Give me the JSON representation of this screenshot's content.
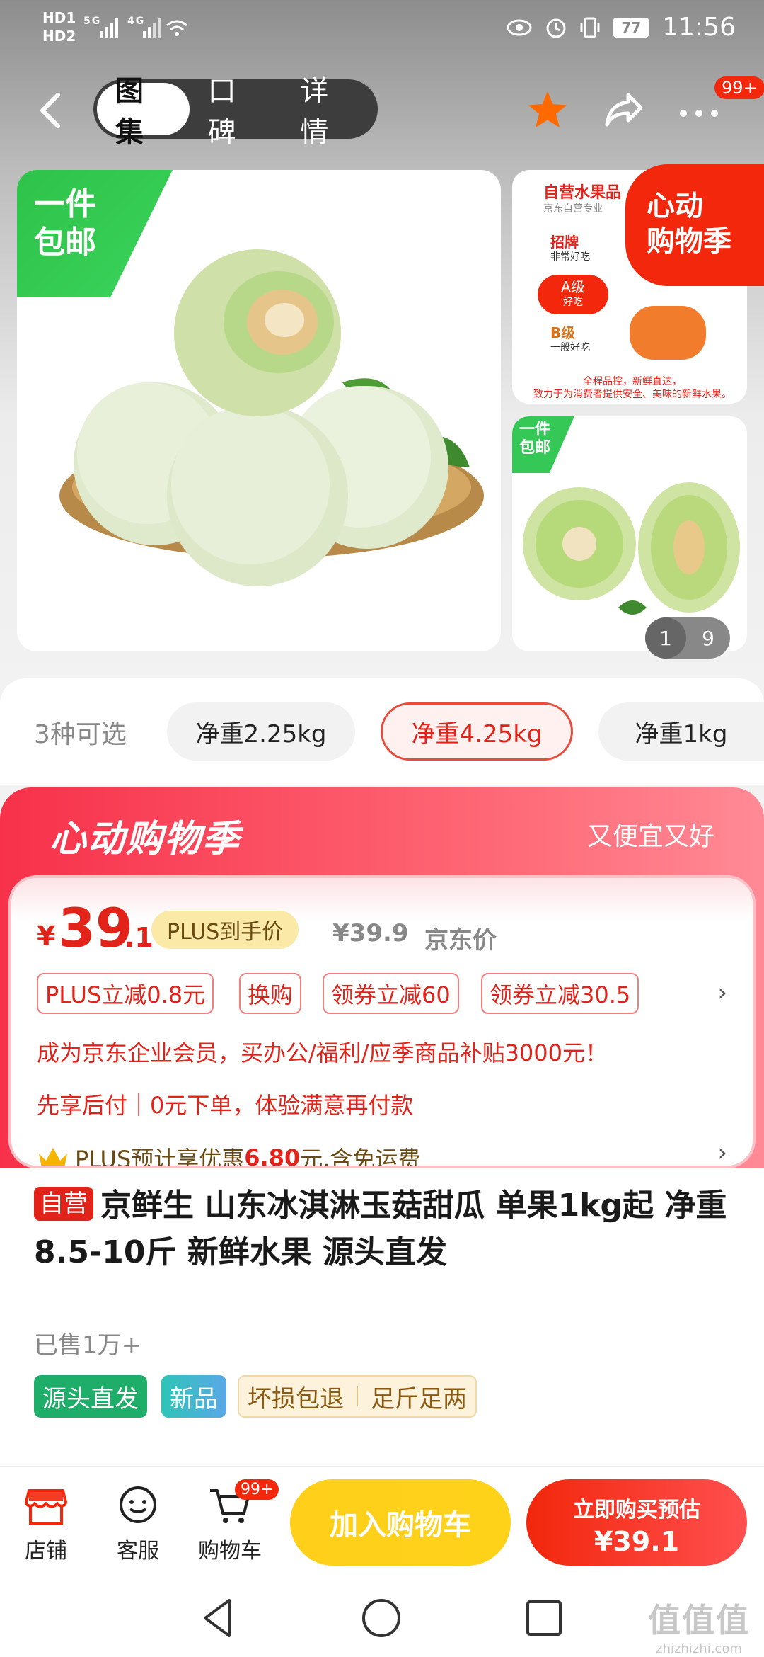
{
  "status_bar": {
    "sim1": "HD1",
    "sim2": "HD2",
    "network": "5G 4G",
    "battery": "77",
    "time": "11:56"
  },
  "header": {
    "tabs": [
      {
        "label": "图集"
      },
      {
        "label": "口碑"
      },
      {
        "label": "详情"
      }
    ],
    "more_badge": "99+"
  },
  "gallery": {
    "main_ribbon_line1": "一件",
    "main_ribbon_line2": "包邮",
    "side1": {
      "title": "自营水果品",
      "subtitle": "京东自营专业",
      "grade1": "招牌",
      "grade1_sub": "非常好吃",
      "grade2": "A级",
      "grade2_sub": "好吃",
      "grade3": "B级",
      "grade3_sub": "一般好吃",
      "footer_line1": "全程品控，新鲜直达，",
      "footer_line2": "致力于为消费者提供安全、美味的新鲜水果。"
    },
    "promo_badge_line1": "心动",
    "promo_badge_line2": "购物季",
    "side2_ribbon_line1": "一件",
    "side2_ribbon_line2": "包邮",
    "counter_current": "1",
    "counter_total": "9"
  },
  "variants": {
    "label": "3种可选",
    "options": [
      "净重2.25kg",
      "净重4.25kg",
      "净重1kg"
    ],
    "selected_index": 1
  },
  "promo": {
    "title": "心动购物季",
    "slogan": "又便宜又好",
    "price_symbol": "¥",
    "price_int": "39",
    "price_dec": ".1",
    "plus_tag": "PLUS到手价",
    "orig_price": "¥39.9",
    "orig_label": "京东价",
    "coupons": [
      "PLUS立减0.8元",
      "换购",
      "领券立减60",
      "领券立减30.5"
    ],
    "chevron": "›",
    "enterprise": "成为京东企业会员，买办公/福利/应季商品补贴3000元！",
    "bnpl": "先享后付｜0元下单，体验满意再付款",
    "plus_est_prefix": "PLUS预计享优惠",
    "plus_est_amount": "6.80",
    "plus_est_suffix": "元,含免运费"
  },
  "product": {
    "self_tag": "自营",
    "title": "京鲜生 山东冰淇淋玉菇甜瓜 单果1kg起 净重8.5-10斤 新鲜水果 源头直发",
    "sold": "已售1万+",
    "tags": [
      "源头直发",
      "新品",
      "坏损包退",
      "足斤足两"
    ]
  },
  "bottom_bar": {
    "shop": "店铺",
    "service": "客服",
    "cart": "购物车",
    "cart_badge": "99+",
    "add_to_cart": "加入购物车",
    "buy_now_line1": "立即购买预估",
    "buy_now_line2": "¥39.1"
  },
  "watermark": {
    "big": "值值值",
    "small": "zhizhizhi.com"
  },
  "colors": {
    "jd_red": "#e2231a",
    "add_cart_yellow": "#ffcf1a",
    "green_ribbon": "#2ec24a"
  }
}
